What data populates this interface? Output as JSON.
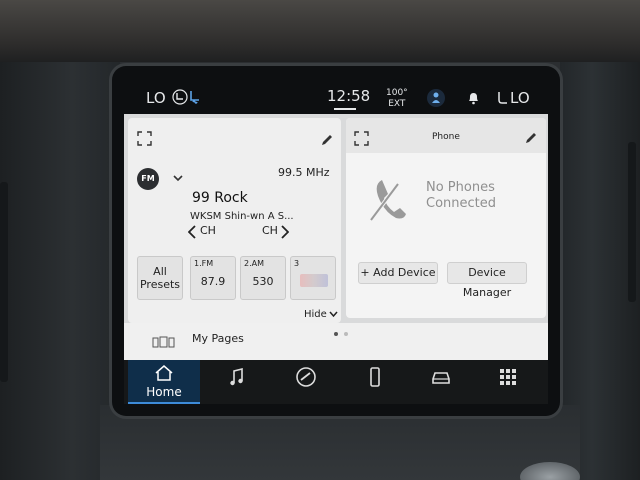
{
  "status_bar": {
    "climate_left": "LO",
    "time": "12:58",
    "temp_value": "100°",
    "temp_label": "EXT",
    "climate_right": "LO"
  },
  "radio": {
    "band": "FM",
    "frequency": "99.5 MHz",
    "station_name": "99 Rock",
    "station_info": "WKSM Shin-wn A S...",
    "ch_prev_label": "CH",
    "ch_next_label": "CH",
    "presets": [
      {
        "label": "",
        "value": "All\nPresets"
      },
      {
        "label": "1.FM",
        "value": "87.9"
      },
      {
        "label": "2.AM",
        "value": "530"
      },
      {
        "label": "3",
        "value": ""
      }
    ],
    "hide_label": "Hide"
  },
  "phone": {
    "title": "Phone",
    "status_line1": "No Phones",
    "status_line2": "Connected",
    "add_device_label": "+ Add Device",
    "device_manager_label": "Device Manager"
  },
  "pages": {
    "label": "My Pages",
    "current_page": 1,
    "page_count": 2
  },
  "nav": {
    "home_label": "Home",
    "items": [
      "home-icon",
      "music-icon",
      "apps-gauge-icon",
      "phone-icon",
      "vehicle-icon",
      "apps-grid-icon"
    ]
  },
  "colors": {
    "active_tab": "#0f2e4a",
    "active_accent": "#3d8bd9",
    "screen_bg": "#d9dadb"
  }
}
